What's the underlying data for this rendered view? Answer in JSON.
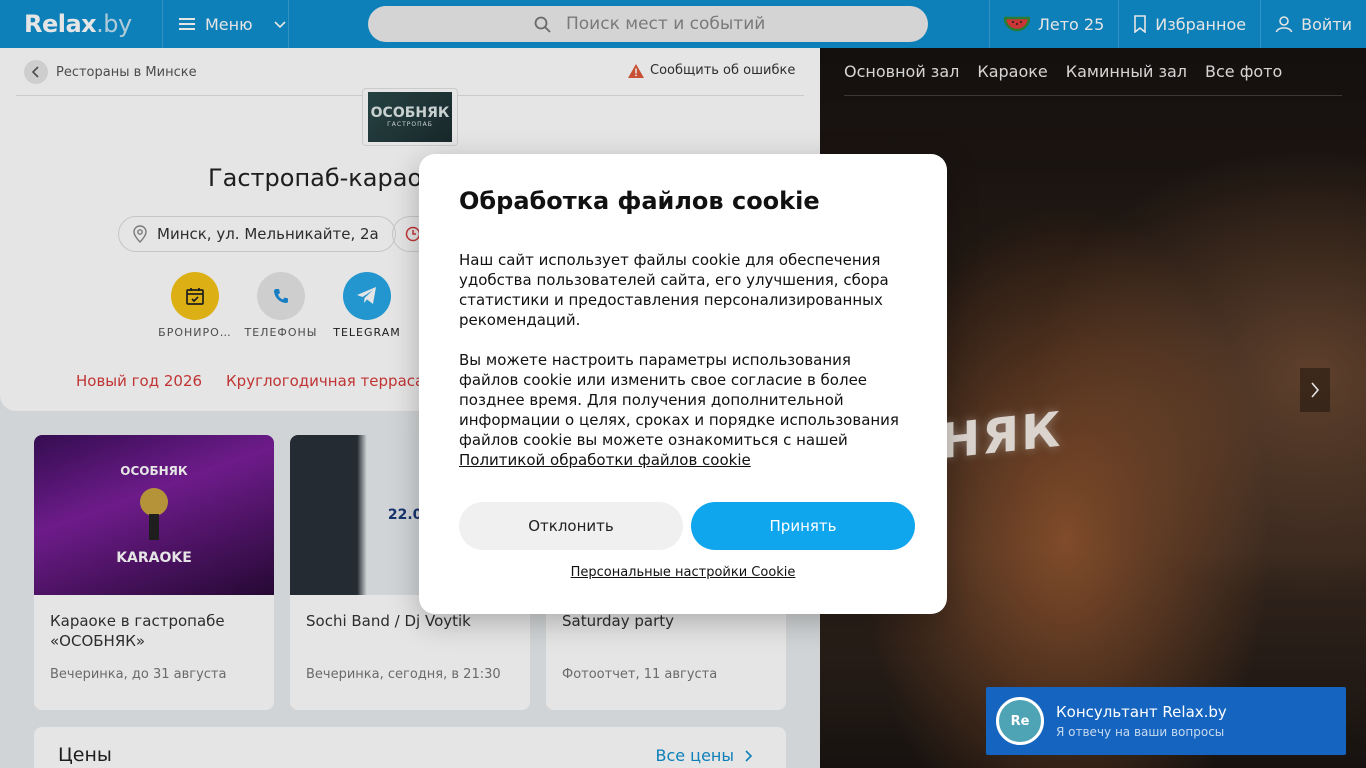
{
  "header": {
    "logo_main": "Relax",
    "logo_suffix": ".by",
    "menu_label": "Меню",
    "search_placeholder": "Поиск мест и событий",
    "summer_label": "Лето 25",
    "favorites_label": "Избранное",
    "login_label": "Войти"
  },
  "page": {
    "breadcrumb": "Рестораны в Минске",
    "report_error": "Сообщить об ошибке",
    "venue_logo_main": "ОСОБНЯК",
    "venue_logo_sub": "ГАСТРОПАБ",
    "venue_title": "Гастропаб-карао",
    "address": "Минск, ул. Мельникайте, 2а",
    "actions": [
      {
        "label": "БРОНИРО…",
        "color": "#f5c518"
      },
      {
        "label": "ТЕЛЕФОНЫ",
        "color": "#e6e6e6"
      },
      {
        "label": "TELEGRAM",
        "color": "#27a7e7"
      }
    ],
    "tags": [
      "Новый год 2026",
      "Круглогодичная терраса"
    ]
  },
  "events": [
    {
      "title": "Караоке в гастропабе «ОСОБНЯК»",
      "subtitle": "Вечеринка, до 31 августа",
      "image_text": "KARAOKE"
    },
    {
      "title": "Sochi Band / Dj Voytik",
      "subtitle": "Вечеринка, сегодня, в 21:30",
      "image_text": "22.08"
    },
    {
      "title": "Saturday party",
      "subtitle": "Фотоотчет, 11 августа",
      "image_text": ""
    }
  ],
  "prices": {
    "title": "Цены",
    "all_link": "Все цены"
  },
  "gallery": {
    "tabs": [
      "Основной зал",
      "Караоке",
      "Каминный зал",
      "Все фото"
    ],
    "sign_text": "НЯК"
  },
  "consultant": {
    "avatar": "Re",
    "name": "Консультант Relax.by",
    "subtitle": "Я отвечу на ваши вопросы"
  },
  "cookie_modal": {
    "title": "Обработка файлов cookie",
    "paragraph1": "Наш сайт использует файлы cookie для обеспечения удобства пользователей сайта, его улучшения, сбора статистики и предоставления персонализированных рекомендаций.",
    "paragraph2": "Вы можете настроить параметры использования файлов cookie или изменить свое согласие в более позднее время. Для получения дополнительной информации о целях, сроках и порядке использования файлов cookie вы можете ознакомиться с нашей",
    "policy_link": "Политикой обработки файлов cookie",
    "decline": "Отклонить",
    "accept": "Принять",
    "personal_settings": "Персональные настройки Cookie"
  },
  "colors": {
    "brand": "#0f8fce",
    "accent": "#0fa6ee",
    "tag_red": "#d63a3a",
    "consultant": "#1565c0"
  }
}
